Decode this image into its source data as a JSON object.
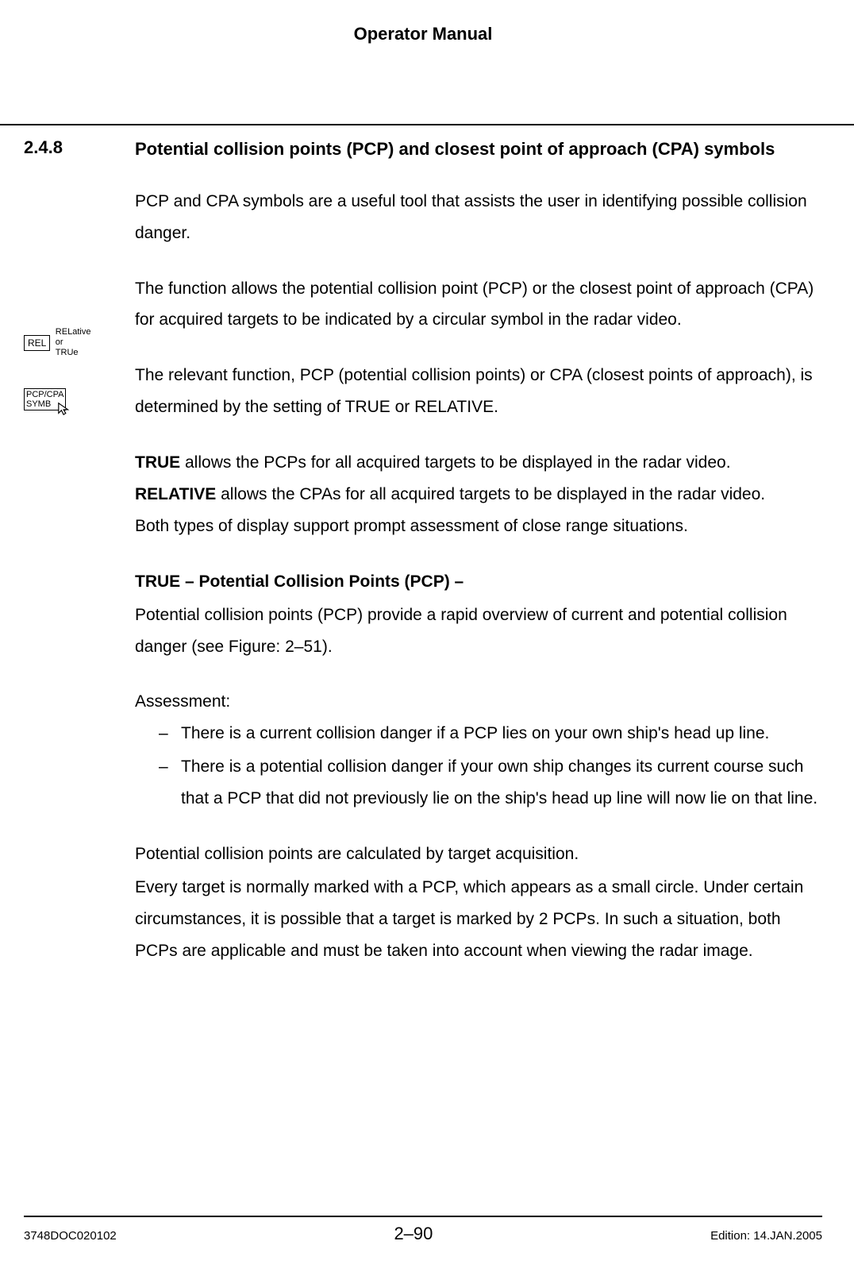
{
  "header": {
    "title": "Operator Manual"
  },
  "section": {
    "number": "2.4.8",
    "title": "Potential collision points (PCP) and closest point of approach (CPA) symbols"
  },
  "margin": {
    "rel_box": "REL",
    "rel_label_line1": "RELative",
    "rel_label_line2": "or",
    "rel_label_line3": "TRUe",
    "pcp_box_line1": "PCP/CPA",
    "pcp_box_line2": "SYMB"
  },
  "body": {
    "p1": "PCP and CPA symbols are a useful tool that assists the user in identifying possible collision danger.",
    "p2": "The function allows the potential collision point (PCP) or the closest point of approach (CPA) for acquired targets to be indicated by a circular symbol in the radar video.",
    "p3": "The relevant function, PCP (potential collision points) or CPA (closest points of approach), is determined by the setting of TRUE or RELATIVE.",
    "p4_true": "TRUE",
    "p4_true_rest": " allows the PCPs for all acquired targets to be displayed in the radar video.",
    "p4_rel": "RELATIVE",
    "p4_rel_rest": " allows the CPAs for all acquired targets to be displayed in the radar video.",
    "p4_both": "Both types of display support prompt assessment of close range situations.",
    "sub1": "TRUE – Potential Collision Points (PCP) –",
    "p5": "Potential collision points (PCP) provide a rapid overview of current and potential collision danger (see Figure: 2–51).",
    "assess_label": "Assessment:",
    "assess1": "There is a current collision danger if a PCP lies on your own ship's head up line.",
    "assess2": "There is a potential collision danger if your own ship changes its current course such that a PCP that did not previously lie on the ship's head up line will now lie on that line.",
    "dash": "–",
    "p6": "Potential collision points are calculated by target acquisition.",
    "p7": "Every target is normally marked with a PCP, which appears as a small circle. Under certain circumstances, it is possible that a target is marked by 2 PCPs. In such a situation, both PCPs are applicable and must be taken into account when viewing the radar image."
  },
  "footer": {
    "left": "3748DOC020102",
    "center": "2–90",
    "right": "Edition: 14.JAN.2005"
  }
}
